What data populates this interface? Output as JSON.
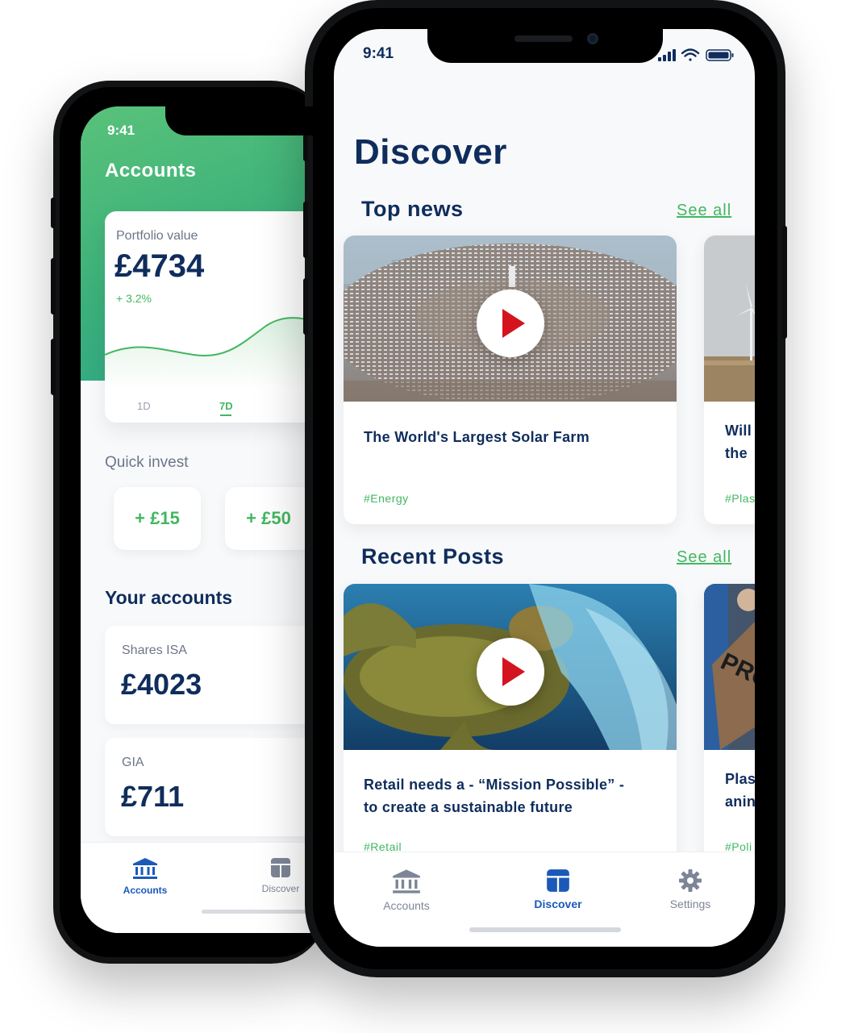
{
  "back_phone": {
    "time": "9:41",
    "title": "Accounts",
    "portfolio": {
      "label": "Portfolio value",
      "value": "£4734",
      "change": "+ 3.2%",
      "ranges": [
        "1D",
        "7D"
      ],
      "selected_range": "7D"
    },
    "quick_invest": {
      "label": "Quick invest",
      "amounts": [
        "+ £15",
        "+ £50"
      ]
    },
    "your_accounts": {
      "label": "Your accounts",
      "items": [
        {
          "name": "Shares ISA",
          "value": "£4023"
        },
        {
          "name": "GIA",
          "value": "£711"
        }
      ]
    },
    "nav": {
      "items": [
        {
          "label": "Accounts",
          "icon": "bank-icon",
          "active": true
        },
        {
          "label": "Discover",
          "icon": "discover-icon",
          "active": false
        }
      ]
    }
  },
  "front_phone": {
    "time": "9:41",
    "title": "Discover",
    "top_news": {
      "label": "Top news",
      "see_all": "See all",
      "cards": [
        {
          "title": "The World's Largest Solar Farm",
          "tag": "#Energy",
          "media": "solar-farm-video"
        },
        {
          "title_line1": "Will",
          "title_line2": "the",
          "tag": "#Plas",
          "media": "wind-turbine-image"
        }
      ]
    },
    "recent_posts": {
      "label": "Recent Posts",
      "see_all": "See all",
      "cards": [
        {
          "title_line1": "Retail needs a - “Mission Possible” -",
          "title_line2": "to create a sustainable future",
          "tag": "#Retail",
          "media": "turtle-plastic-video"
        },
        {
          "title_line1": "Plas",
          "title_line2": "anin",
          "tag": "#Poli",
          "media": "protest-image",
          "sign_text": "PRO"
        }
      ]
    },
    "nav": {
      "items": [
        {
          "label": "Accounts",
          "icon": "bank-icon",
          "active": false
        },
        {
          "label": "Discover",
          "icon": "discover-icon",
          "active": true
        },
        {
          "label": "Settings",
          "icon": "gear-icon",
          "active": false
        }
      ]
    }
  },
  "colors": {
    "navy": "#0f2d5c",
    "green": "#42b760",
    "nav_active": "#1b59b8",
    "nav_inactive": "#7d8596",
    "play_red": "#d3141f"
  }
}
